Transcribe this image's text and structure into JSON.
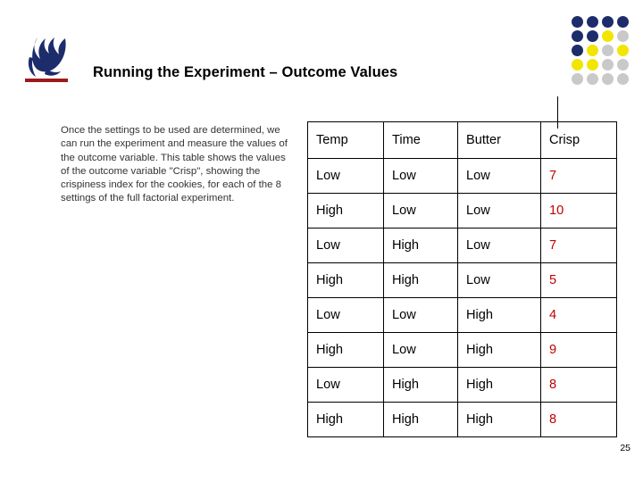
{
  "slide": {
    "title": "Running the Experiment – Outcome Values",
    "body": "Once the settings to be used are determined, we can run the experiment and measure the values of the outcome variable. This table shows the values of the outcome variable \"Crisp\", showing the crispiness index for the cookies, for each of the 8 settings of the full factorial experiment.",
    "number": "25"
  },
  "logo": {
    "name": "gsu-torch-logo",
    "color": "#1d2c6b",
    "underline_color": "#9b1b1b"
  },
  "dot_grid": {
    "colors": {
      "navy": "#1d2c6b",
      "yellow": "#f2e500",
      "gray": "#c9c9c9"
    },
    "rows": [
      [
        "navy",
        "navy",
        "navy",
        "navy"
      ],
      [
        "navy",
        "navy",
        "yellow",
        "gray"
      ],
      [
        "navy",
        "yellow",
        "gray",
        "yellow"
      ],
      [
        "yellow",
        "yellow",
        "gray",
        "gray"
      ],
      [
        "gray",
        "gray",
        "gray",
        "gray"
      ]
    ]
  },
  "table": {
    "headers": [
      "Temp",
      "Time",
      "Butter",
      "Crisp"
    ],
    "crisp_color": "#c00000",
    "rows": [
      [
        "Low",
        "Low",
        "Low",
        "7"
      ],
      [
        "High",
        "Low",
        "Low",
        "10"
      ],
      [
        "Low",
        "High",
        "Low",
        "7"
      ],
      [
        "High",
        "High",
        "Low",
        "5"
      ],
      [
        "Low",
        "Low",
        "High",
        "4"
      ],
      [
        "High",
        "Low",
        "High",
        "9"
      ],
      [
        "Low",
        "High",
        "High",
        "8"
      ],
      [
        "High",
        "High",
        "High",
        "8"
      ]
    ]
  }
}
